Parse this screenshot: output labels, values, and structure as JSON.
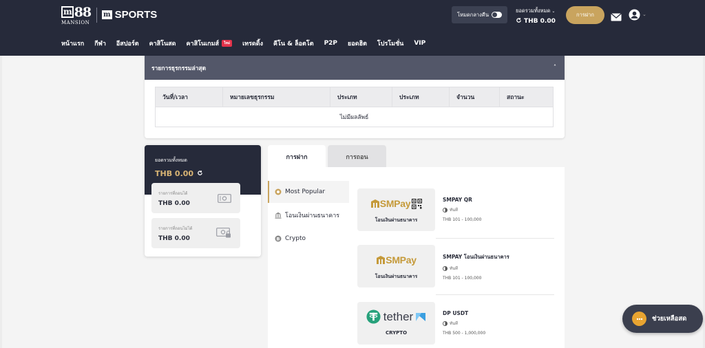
{
  "header": {
    "logo_brand": "88",
    "logo_sub": "MANSION",
    "logo_sports": "SPORTS",
    "theme_label": "โหมดกลางคืน",
    "balance_label": "ยอดรวมทั้งหมด",
    "balance_value": "THB 0.00",
    "deposit_button": "การฝาก"
  },
  "nav": [
    "หน้าแรก",
    "กีฬา",
    "อีสปอร์ต",
    "คาสิโนสด",
    "คาสิโนเกมส์",
    "เทรดดิ้ง",
    "คีโน & ล็อตโต",
    "P2P",
    "ยอดฮิต",
    "โปรโมชั่น",
    "VIP"
  ],
  "nav_badge": "ใหม่",
  "transactions": {
    "title": "รายการธุรกรรมล่าสุด",
    "columns": [
      "วันที่/เวลา",
      "หมายเลขธุรกรรม",
      "ประเภท",
      "ประเภท",
      "จำนวน",
      "สถานะ"
    ],
    "empty_text": "ไม่มีผลลัพธ์"
  },
  "wallet": {
    "total_label": "ยอดรวมทั้งหมด",
    "total_value": "THB 0.00",
    "withdrawable_label": "รายการที่ถอนได้",
    "withdrawable_value": "THB 0.00",
    "non_withdrawable_label": "รายการที่ถอนไม่ได้",
    "non_withdrawable_value": "THB 0.00"
  },
  "tabs": {
    "deposit": "การฝาก",
    "withdraw": "การถอน"
  },
  "methods": [
    {
      "label": "Most Popular",
      "icon": "star-circle-icon"
    },
    {
      "label": "โอนเงินผ่านธนาคาร",
      "icon": "bank-icon"
    },
    {
      "label": "Crypto",
      "icon": "crypto-icon"
    }
  ],
  "options": [
    {
      "brand": "SMPay",
      "sub": "โอนเงินผ่านธนาคาร",
      "name": "SMPAY QR",
      "time": "ทันที",
      "limit": "THB 101 - 100,000"
    },
    {
      "brand": "SMPay",
      "sub": "โอนเงินผ่านธนาคาร",
      "name": "SMPAY โอนเงินผ่านธนาคาร",
      "time": "ทันที",
      "limit": "THB 101 - 100,000"
    },
    {
      "brand": "tether",
      "sub": "CRYPTO",
      "name": "DP USDT",
      "time": "ทันที",
      "limit": "THB 500 - 1,000,000"
    }
  ],
  "help_button": "ช่วยเหลือสด",
  "colors": {
    "header_bg": "#262a3a",
    "accent_gold": "#c9a45e",
    "tether_green": "#26a17b"
  }
}
